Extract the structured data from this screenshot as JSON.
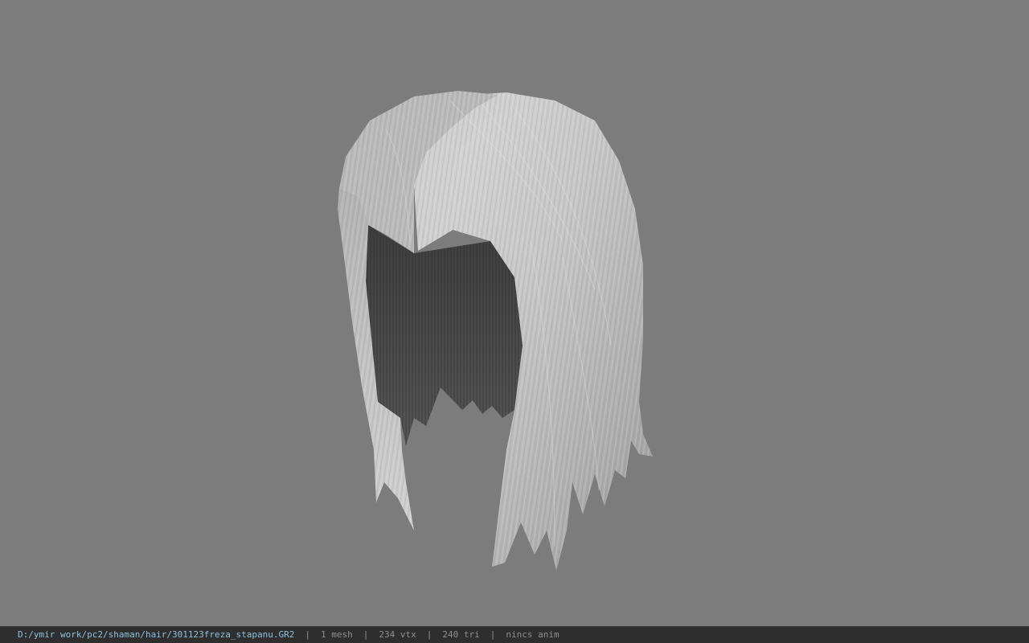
{
  "viewport": {
    "background_color": "#7c7c7c",
    "model_icon": "hair-mesh",
    "hair_color": "#c8c8c8",
    "hair_shadow_color": "#4a4a4a"
  },
  "status_bar": {
    "file_path": "D:/ymir work/pc2/shaman/hair/301123freza_stapanu.GR2",
    "separator": "|",
    "mesh_count": "1 mesh",
    "vertex_count": "234 vtx",
    "triangle_count": "240 tri",
    "animation": "nincs anim",
    "path_color": "#8fc1da",
    "text_color": "#8f8f8f",
    "background_color": "#2e2e2e"
  }
}
